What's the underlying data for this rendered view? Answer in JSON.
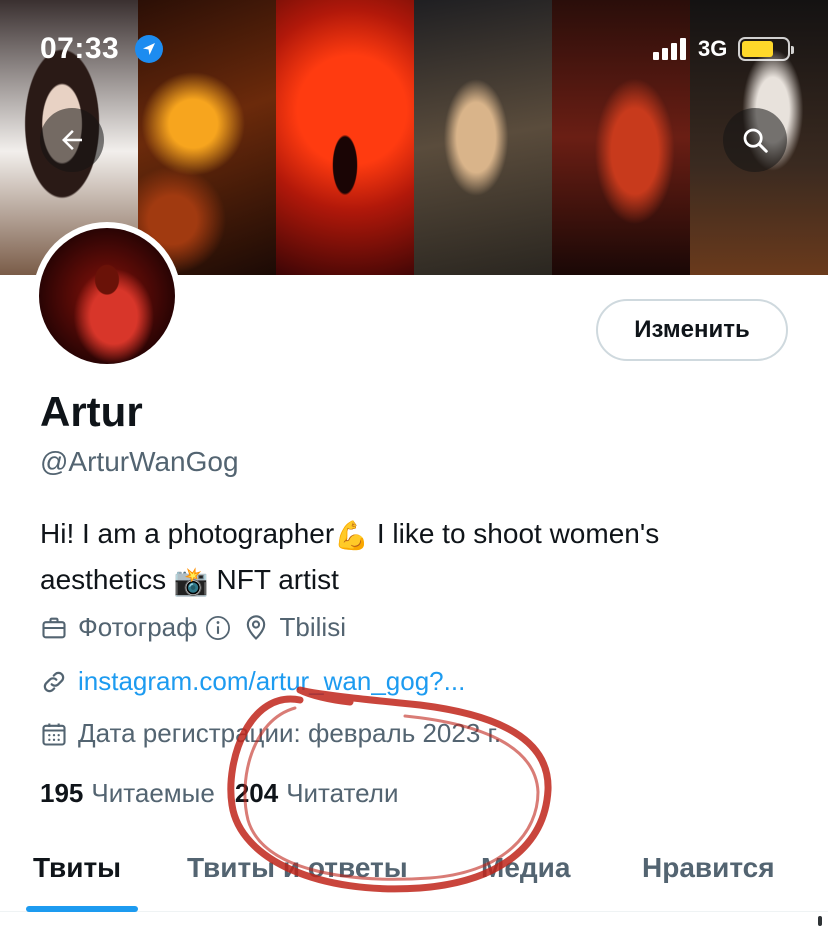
{
  "status_bar": {
    "time": "07:33",
    "network": "3G",
    "location_icon": "location-arrow-icon",
    "battery_color": "#ffd82a"
  },
  "header": {
    "back_icon": "arrow-left-icon",
    "search_icon": "search-icon"
  },
  "profile": {
    "edit_label": "Изменить",
    "name": "Artur",
    "handle": "@ArturWanGog",
    "bio_line1_a": "Hi! I am a photographer",
    "bio_emoji1": "💪",
    "bio_line1_b": " I like to shoot women's",
    "bio_line2_a": "aesthetics ",
    "bio_emoji2": "📸",
    "bio_line2_b": " NFT artist",
    "profession": "Фотограф",
    "location": "Tbilisi",
    "link": "instagram.com/artur_wan_gog?...",
    "joined": "Дата регистрации: февраль 2023 г.",
    "following_count": "195",
    "following_label": "Читаемые",
    "followers_count": "204",
    "followers_label": "Читатели"
  },
  "tabs": [
    {
      "label": "Твиты",
      "active": true
    },
    {
      "label": "Твиты и ответы",
      "active": false
    },
    {
      "label": "Медиа",
      "active": false
    },
    {
      "label": "Нравится",
      "active": false
    }
  ],
  "colors": {
    "accent": "#1d9bf0",
    "secondary_text": "#536471",
    "annotation": "#c0241a"
  }
}
